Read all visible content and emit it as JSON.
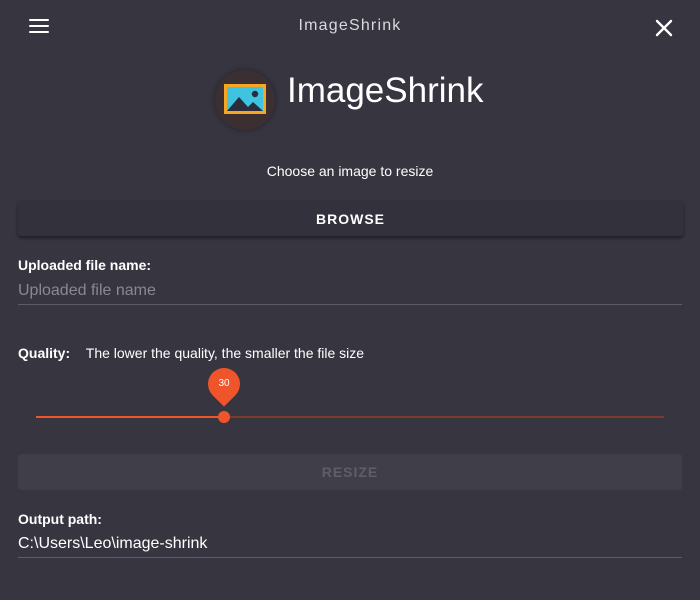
{
  "window": {
    "title": "ImageShrink",
    "menu_icon": "hamburger-menu-icon",
    "close_icon": "close-icon"
  },
  "header": {
    "app_name": "ImageShrink",
    "logo_icon": "image-icon"
  },
  "instruction": "Choose an image to resize",
  "browse": {
    "label": "BROWSE"
  },
  "upload": {
    "label": "Uploaded file name:",
    "value": "",
    "placeholder": "Uploaded file name"
  },
  "quality": {
    "label": "Quality:",
    "description": "The lower the quality, the smaller the file size",
    "value": 30,
    "min": 0,
    "max": 100,
    "value_text": "30"
  },
  "resize": {
    "label": "RESIZE",
    "disabled": true
  },
  "output": {
    "label": "Output path:",
    "value": "C:\\Users\\Leo\\image-shrink"
  },
  "colors": {
    "background": "#363540",
    "accent": "#f0542b",
    "text": "#ffffff",
    "logo_frame": "#f5a623",
    "logo_sky": "#3ec3e0"
  }
}
